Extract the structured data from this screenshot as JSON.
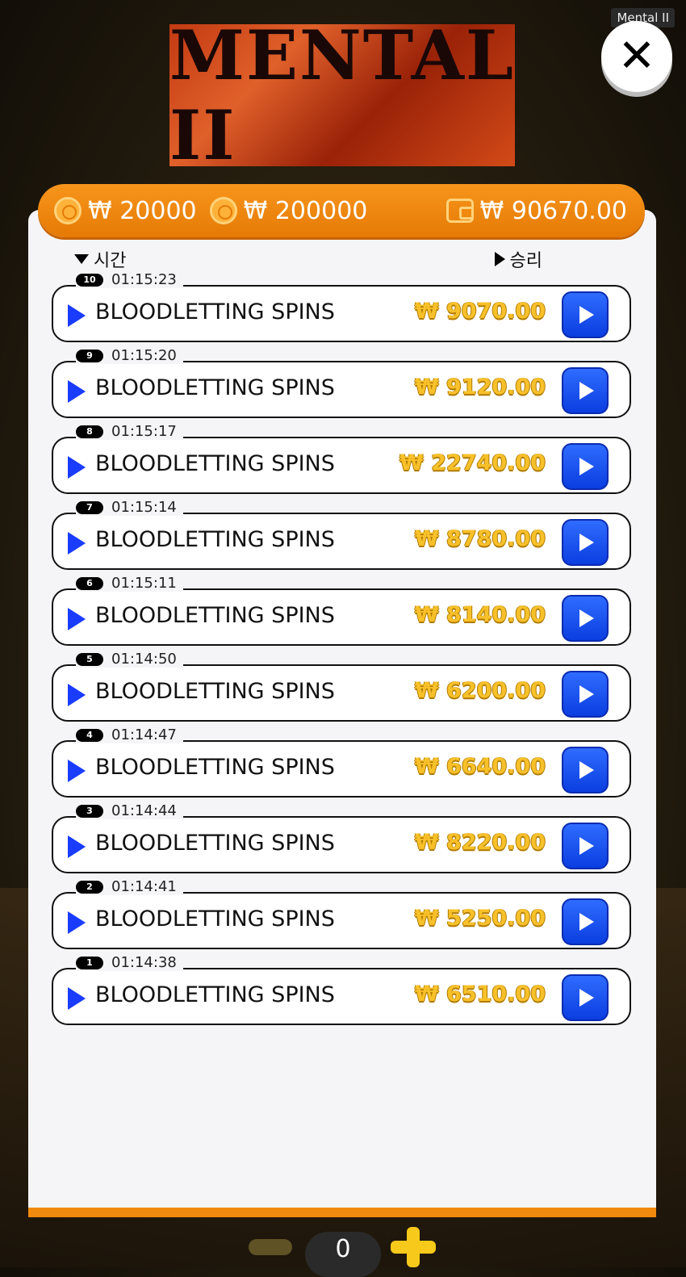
{
  "window_title": "Mental II",
  "logo_text": "MENTAL II",
  "header": {
    "currency": "₩",
    "bet": "₩ 20000",
    "total_bet": "₩ 200000",
    "balance": "₩ 90670.00"
  },
  "sort": {
    "time_label": "시간",
    "win_label": "승리"
  },
  "entries": [
    {
      "index": "10",
      "time": "01:15:23",
      "feature": "BLOODLETTING SPINS",
      "amount": "₩ 9070.00"
    },
    {
      "index": "9",
      "time": "01:15:20",
      "feature": "BLOODLETTING SPINS",
      "amount": "₩ 9120.00"
    },
    {
      "index": "8",
      "time": "01:15:17",
      "feature": "BLOODLETTING SPINS",
      "amount": "₩ 22740.00"
    },
    {
      "index": "7",
      "time": "01:15:14",
      "feature": "BLOODLETTING SPINS",
      "amount": "₩ 8780.00"
    },
    {
      "index": "6",
      "time": "01:15:11",
      "feature": "BLOODLETTING SPINS",
      "amount": "₩ 8140.00"
    },
    {
      "index": "5",
      "time": "01:14:50",
      "feature": "BLOODLETTING SPINS",
      "amount": "₩ 6200.00"
    },
    {
      "index": "4",
      "time": "01:14:47",
      "feature": "BLOODLETTING SPINS",
      "amount": "₩ 6640.00"
    },
    {
      "index": "3",
      "time": "01:14:44",
      "feature": "BLOODLETTING SPINS",
      "amount": "₩ 8220.00"
    },
    {
      "index": "2",
      "time": "01:14:41",
      "feature": "BLOODLETTING SPINS",
      "amount": "₩ 5250.00"
    },
    {
      "index": "1",
      "time": "01:14:38",
      "feature": "BLOODLETTING SPINS",
      "amount": "₩ 6510.00"
    }
  ],
  "footer": {
    "spin_count": "0"
  },
  "colors": {
    "accent": "#f08a0e",
    "play_blue": "#1a3cff",
    "amount_gold": "#f8c12a"
  }
}
